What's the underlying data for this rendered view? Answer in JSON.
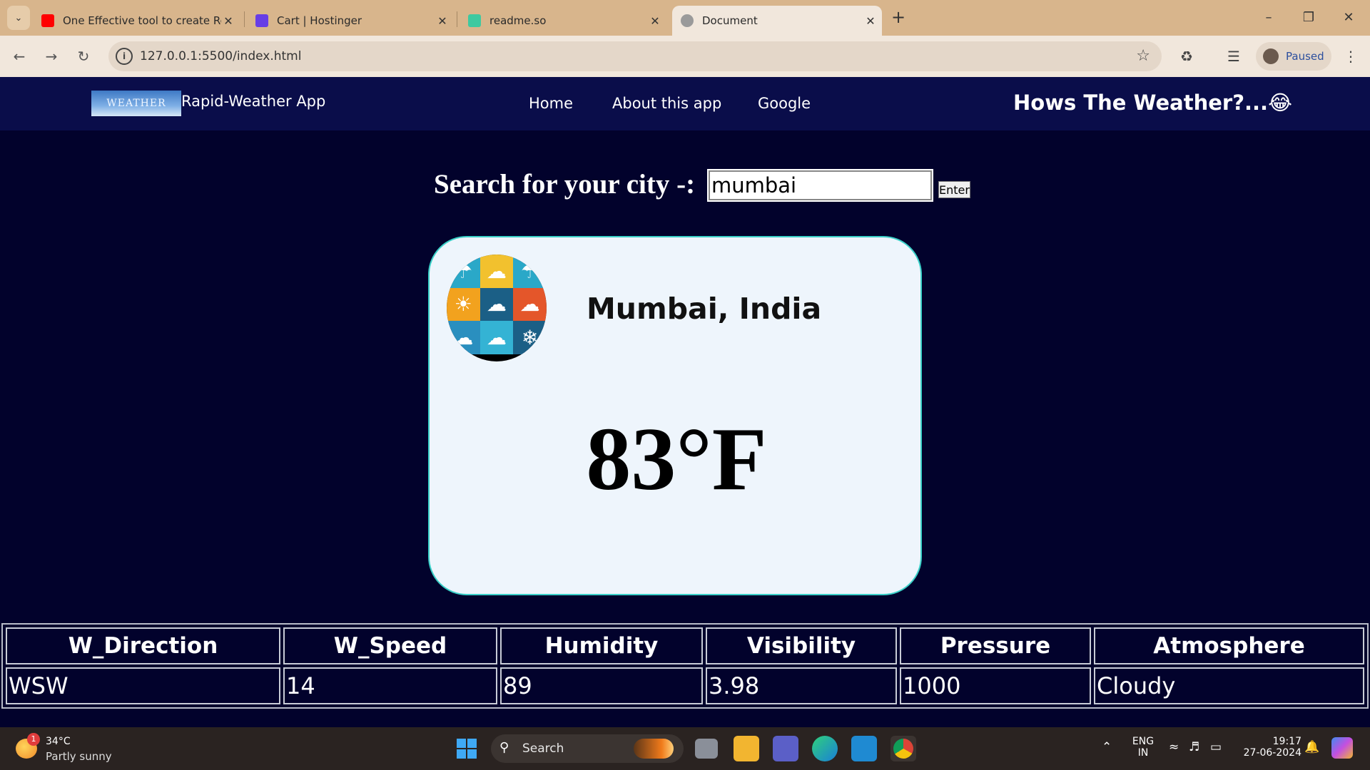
{
  "browser": {
    "tabs": [
      {
        "title": "One Effective tool to create Rea",
        "favicon": "youtube-icon",
        "active": false
      },
      {
        "title": "Cart | Hostinger",
        "favicon": "hostinger-icon",
        "active": false
      },
      {
        "title": "readme.so",
        "favicon": "readme-icon",
        "active": false
      },
      {
        "title": "Document",
        "favicon": "globe-icon",
        "active": true
      }
    ],
    "address": "127.0.0.1:5500/index.html",
    "profile_status": "Paused"
  },
  "page": {
    "logo_text": "WEATHER",
    "brand": "Rapid-Weather App",
    "nav": [
      "Home",
      "About this app",
      "Google"
    ],
    "headline": "Hows The Weather?...",
    "headline_emoji": "😂",
    "search": {
      "label": "Search for your city -:",
      "value": "mumbai",
      "button": "Enter"
    },
    "card": {
      "city": "Mumbai, India",
      "temperature": "83°F"
    },
    "stats": {
      "headers": [
        "W_Direction",
        "W_Speed",
        "Humidity",
        "Visibility",
        "Pressure",
        "Atmosphere"
      ],
      "values": [
        "WSW",
        "14",
        "89",
        "3.98",
        "1000",
        "Cloudy"
      ]
    }
  },
  "taskbar": {
    "weather_badge": "1",
    "weather_temp": "34°C",
    "weather_desc": "Partly sunny",
    "search_label": "Search",
    "lang_line1": "ENG",
    "lang_line2": "IN",
    "time": "19:17",
    "date": "27-06-2024"
  },
  "colors": {
    "page_bg": "#02022c",
    "navbar_bg": "#0a0d4a",
    "card_bg": "#eef5fc",
    "card_border": "#3ad0c8",
    "tabbar_bg": "#d8b58c"
  }
}
